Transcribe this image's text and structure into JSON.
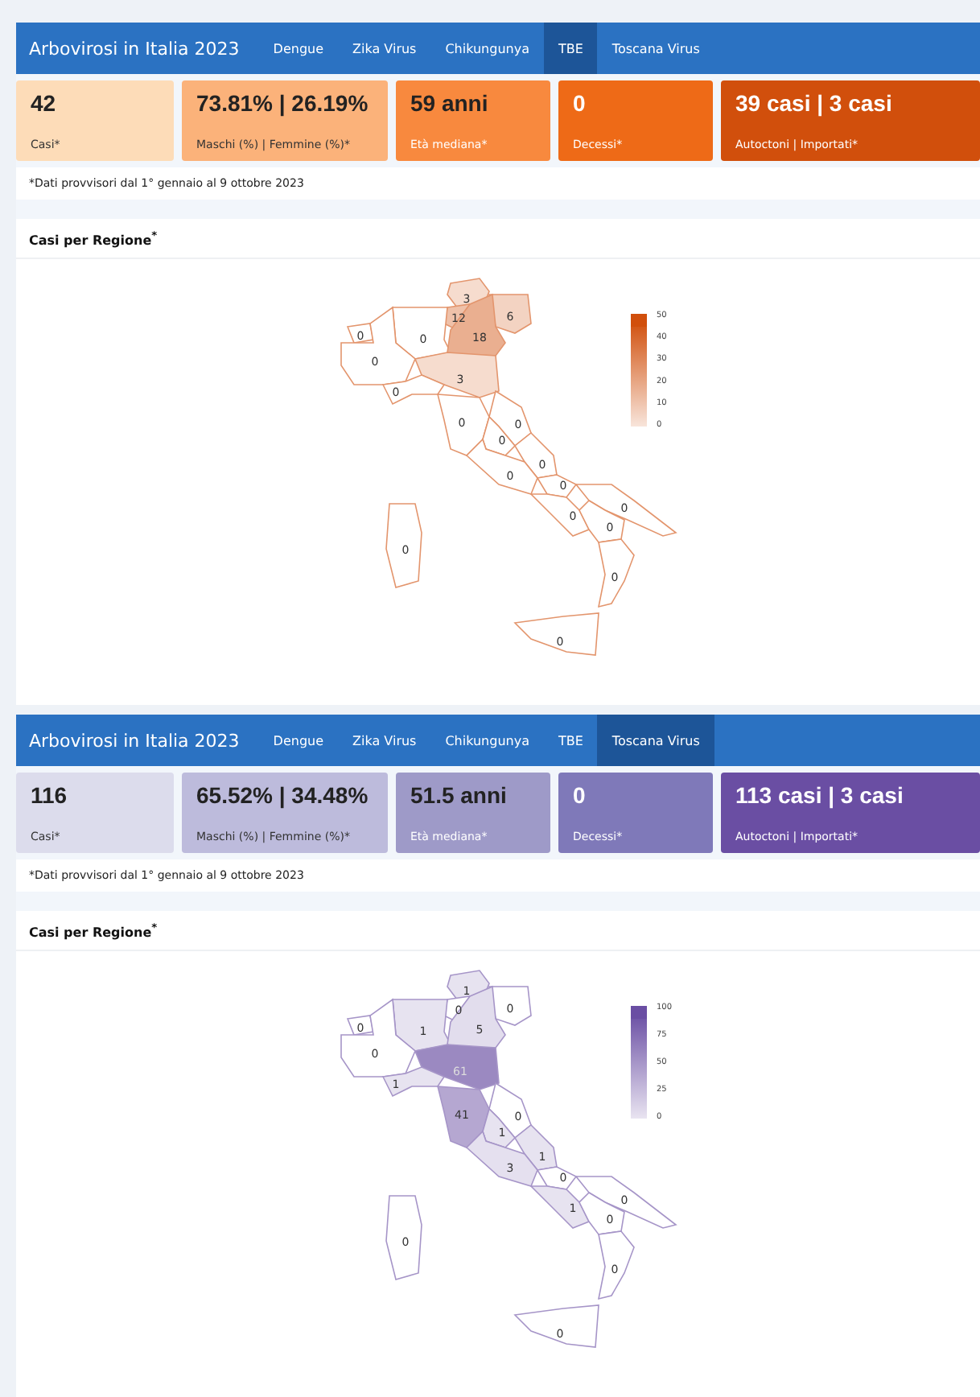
{
  "panels": [
    {
      "title": "Arbovirosi in Italia 2023",
      "tabs": [
        {
          "label": "Dengue",
          "selected": false
        },
        {
          "label": "Zika Virus",
          "selected": false
        },
        {
          "label": "Chikungunya",
          "selected": false
        },
        {
          "label": "TBE",
          "selected": true
        },
        {
          "label": "Toscana Virus",
          "selected": false
        }
      ],
      "cards": [
        {
          "value": "42",
          "label": "Casi*",
          "color": "#fddcb8"
        },
        {
          "value": "73.81% | 26.19%",
          "label": "Maschi (%) | Femmine (%)*",
          "color": "#fbb27a"
        },
        {
          "value": "59 anni",
          "label": "Età mediana*",
          "color": "#f8893e"
        },
        {
          "value": "0",
          "label": "Decessi*",
          "color": "#ee6a17"
        },
        {
          "value": "39 casi | 3 casi",
          "label": "Autoctoni | Importati*",
          "color": "#d14f0c"
        }
      ],
      "note": "*Dati provvisori dal 1° gennaio al 9 ottobre 2023",
      "section_title": "Casi per Regione$^{*}$",
      "map": {
        "legend_ticks": [
          "50",
          "40",
          "30",
          "20",
          "10",
          "0"
        ],
        "region_values": [
          "3",
          "12",
          "6",
          "0",
          "0",
          "18",
          "0",
          "3",
          "0",
          "0",
          "0",
          "0",
          "0",
          "0",
          "0",
          "0",
          "0",
          "0",
          "0",
          "0",
          "0"
        ]
      }
    },
    {
      "title": "Arbovirosi in Italia 2023",
      "tabs": [
        {
          "label": "Dengue",
          "selected": false
        },
        {
          "label": "Zika Virus",
          "selected": false
        },
        {
          "label": "Chikungunya",
          "selected": false
        },
        {
          "label": "TBE",
          "selected": false
        },
        {
          "label": "Toscana Virus",
          "selected": true
        }
      ],
      "cards": [
        {
          "value": "116",
          "label": "Casi*",
          "color": "#dcdcec"
        },
        {
          "value": "65.52% | 34.48%",
          "label": "Maschi (%) | Femmine (%)*",
          "color": "#bdbbdc"
        },
        {
          "value": "51.5 anni",
          "label": "Età mediana*",
          "color": "#9e9ac8"
        },
        {
          "value": "0",
          "label": "Decessi*",
          "color": "#7f79b9"
        },
        {
          "value": "113 casi | 3 casi",
          "label": "Autoctoni | Importati*",
          "color": "#6a4ea3"
        }
      ],
      "note": "*Dati provvisori dal 1° gennaio al 9 ottobre 2023",
      "section_title": "Casi per Regione$^{*}$",
      "map": {
        "legend_ticks": [
          "100",
          "75",
          "50",
          "25",
          "0"
        ],
        "region_values": [
          "1",
          "0",
          "0",
          "0",
          "1",
          "5",
          "0",
          "61",
          "1",
          "41",
          "0",
          "1",
          "1",
          "3",
          "0",
          "0",
          "1",
          "0",
          "0",
          "0",
          "0"
        ]
      }
    }
  ]
}
